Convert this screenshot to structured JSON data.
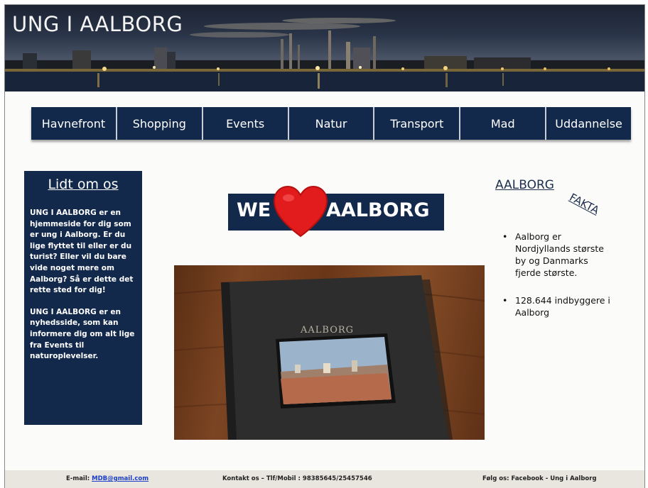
{
  "header": {
    "title": "UNG I AALBORG"
  },
  "nav": {
    "items": [
      {
        "label": "Havnefront"
      },
      {
        "label": "Shopping"
      },
      {
        "label": "Events"
      },
      {
        "label": "Natur"
      },
      {
        "label": "Transport"
      },
      {
        "label": "Mad"
      },
      {
        "label": "Uddannelse"
      }
    ]
  },
  "about": {
    "title": "Lidt om os",
    "paragraph1": "UNG I AALBORG er en hjemmeside for dig som er ung i Aalborg. Er du lige flyttet til eller er du turist? Eller vil du bare vide noget mere om Aalborg? Så er dette det rette sted for dig!",
    "paragraph2": "UNG I AALBORG er en nyhedsside, som kan informere dig om alt lige fra Events til naturoplevelser."
  },
  "banner_logo": {
    "we": "WE",
    "city": "AALBORG"
  },
  "photo": {
    "book_title": "AALBORG"
  },
  "fakta": {
    "title": "AALBORG",
    "tag": "FAKTA",
    "items": [
      {
        "text": "Aalborg er Nordjyllands største by og Danmarks fjerde største."
      },
      {
        "text": "128.644 indbyggere i Aalborg"
      }
    ]
  },
  "footer": {
    "email_label": "E-mail:",
    "email": "MDB@gmail.com",
    "contact": "Kontakt os – Tlf/Mobil : 98385645/25457546",
    "follow": "Følg os: Facebook - Ung i Aalborg"
  },
  "colors": {
    "navy": "#13294b",
    "heart": "#e21c1c",
    "footer_bg": "#e8e6de"
  }
}
